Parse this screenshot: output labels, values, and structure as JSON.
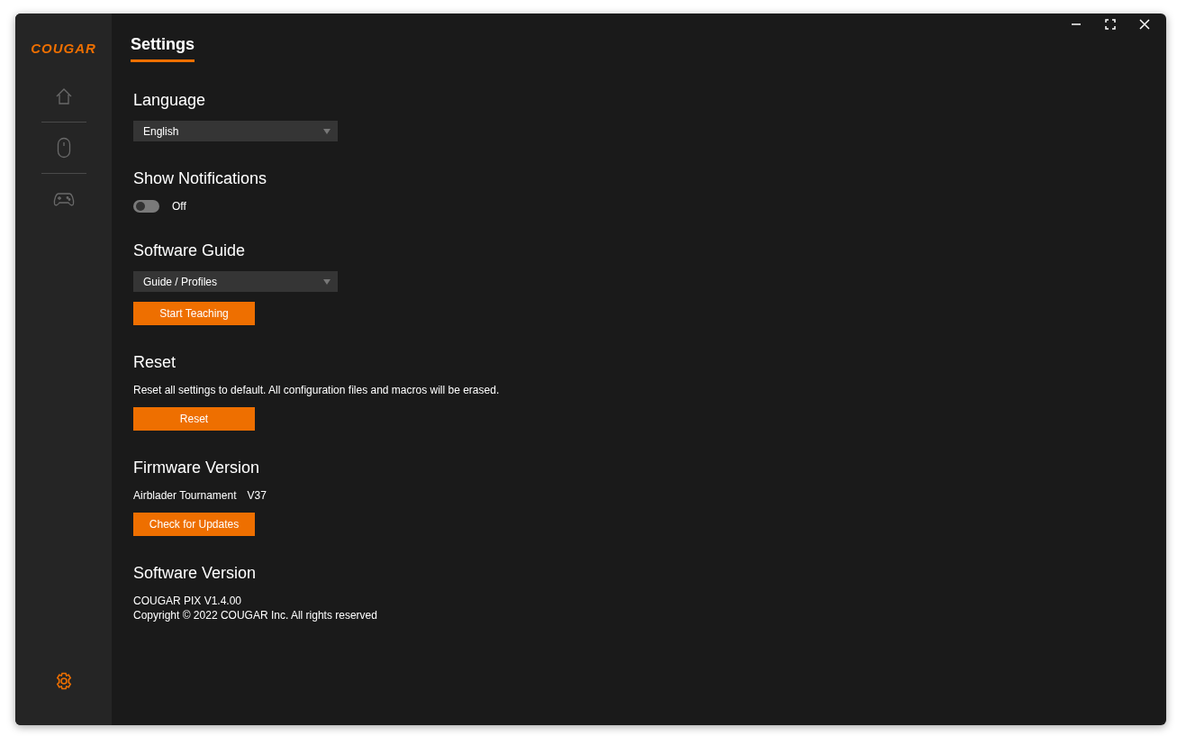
{
  "logo": "COUGAR",
  "sidebar": {
    "items": [
      {
        "kind": "home",
        "selected": false
      },
      {
        "kind": "mouse",
        "selected": false
      },
      {
        "kind": "gamepad",
        "selected": false
      }
    ],
    "settings": {
      "selected": true
    }
  },
  "page_title": {
    "label": "Settings",
    "selected": true
  },
  "sections": [
    {
      "heading": "Language",
      "items": [
        {
          "kind": "select",
          "value": "English"
        }
      ]
    },
    {
      "heading": "Show Notifications",
      "items": [
        {
          "kind": "toggle",
          "on": false,
          "label": "Off"
        }
      ]
    },
    {
      "heading": "Software Guide",
      "items": [
        {
          "kind": "select",
          "value": "Guide / Profiles"
        },
        {
          "kind": "button",
          "label": "Start Teaching"
        }
      ]
    },
    {
      "heading": "Reset",
      "items": [
        {
          "kind": "text",
          "lines": [
            "Reset all settings to default. All configuration files and macros will be erased."
          ]
        },
        {
          "kind": "button",
          "label": "Reset"
        }
      ]
    },
    {
      "heading": "Firmware Version",
      "items": [
        {
          "kind": "pair",
          "name": "Airblader Tournament",
          "value": "V37"
        },
        {
          "kind": "button",
          "label": "Check for Updates"
        }
      ]
    },
    {
      "heading": "Software Version",
      "items": [
        {
          "kind": "text",
          "lines": [
            "COUGAR PIX V1.4.00",
            "Copyright © 2022 COUGAR Inc. All rights reserved"
          ]
        }
      ]
    }
  ]
}
